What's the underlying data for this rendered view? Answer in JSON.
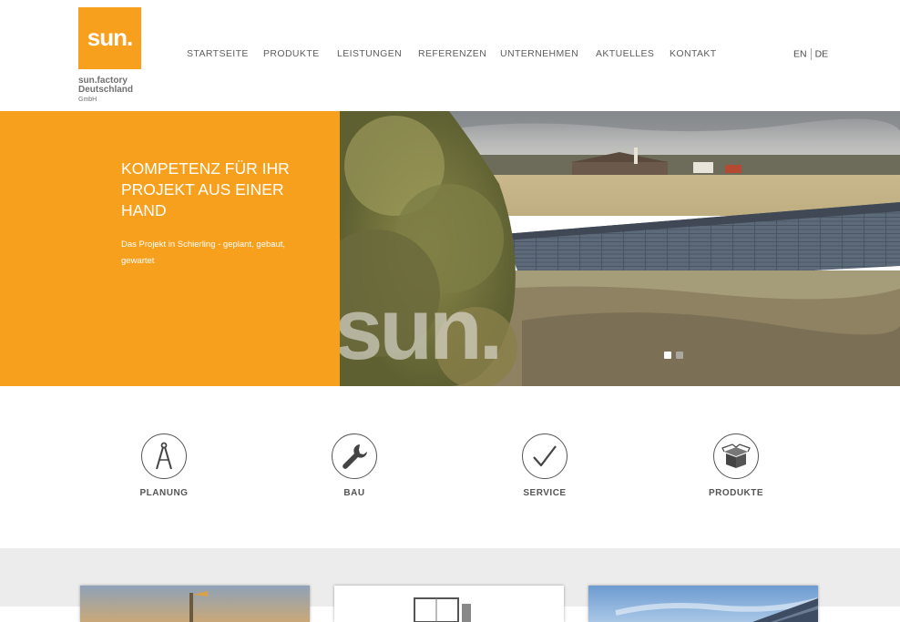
{
  "logo": {
    "mark": "sun.",
    "line1": "sun.factory",
    "line2": "Deutschland",
    "line3": "GmbH"
  },
  "nav": {
    "items": [
      "STARTSEITE",
      "PRODUKTE",
      "LEISTUNGEN",
      "REFERENZEN",
      "UNTERNEHMEN",
      "AKTUELLES",
      "KONTAKT"
    ]
  },
  "lang": {
    "en": "EN",
    "de": "DE"
  },
  "hero": {
    "title": "KOMPETENZ FÜR IHR PROJEKT AUS EINER HAND",
    "text": "Das Projekt in Schierling - geplant, gebaut, gewartet",
    "watermark": "sun.",
    "active_slide": 1,
    "slide_count": 2
  },
  "features": [
    {
      "label": "PLANUNG",
      "icon": "compass-icon"
    },
    {
      "label": "BAU",
      "icon": "wrench-icon"
    },
    {
      "label": "SERVICE",
      "icon": "checkmark-icon"
    },
    {
      "label": "PRODUKTE",
      "icon": "box-icon"
    }
  ],
  "colors": {
    "accent": "#f7a01d",
    "nav_text": "#5e5e5e",
    "section_bg": "#ececec"
  }
}
